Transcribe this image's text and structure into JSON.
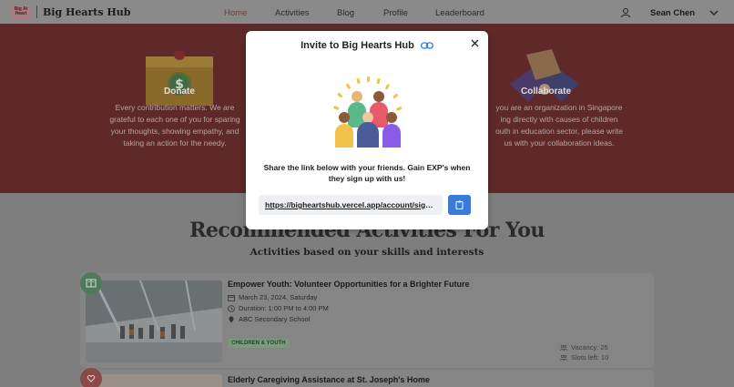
{
  "navbar": {
    "logo_text": "Big At Heart",
    "brand": "Big Hearts Hub",
    "links": [
      {
        "label": "Home",
        "active": true
      },
      {
        "label": "Activities",
        "active": false
      },
      {
        "label": "Blog",
        "active": false
      },
      {
        "label": "Profile",
        "active": false
      },
      {
        "label": "Leaderboard",
        "active": false
      }
    ],
    "user_icon": "user-icon",
    "user_name": "Sean Chen",
    "menu_icon": "chevron-down-icon"
  },
  "hero": {
    "donate": {
      "title": "Donate",
      "text_lines": [
        "Every contribution matters. We are",
        "grateful to each one of you for sparing",
        "your thoughts, showing empathy, and",
        "taking an action for the needy."
      ]
    },
    "collaborate": {
      "title": "Collaborate",
      "text_lines": [
        "you are an organization in Singapore",
        "ing directly with causes of children",
        "outh in education sector, please write",
        "us with your collaboration ideas."
      ]
    }
  },
  "section": {
    "heading": "Recommended Activities For You",
    "subheading": "Activities based on your skills and interests"
  },
  "activities": [
    {
      "title": "Empower Youth: Volunteer Opportunities for a Brighter Future",
      "date": "March 23, 2024, Saturday",
      "duration": "Duration: 1:00 PM to 4:00 PM",
      "location": "ABC Secondary School",
      "tag": "CHILDREN & YOUTH",
      "vacancy": "Vacancy: 25",
      "slots_left": "Slots left: 10",
      "badge_icon": "book-icon",
      "badge_color": "#4f7a5a"
    },
    {
      "title": "Elderly Caregiving Assistance at St. Joseph's Home",
      "badge_icon": "heart-hand-icon",
      "badge_color": "#8a4a4a"
    }
  ],
  "modal": {
    "title": "Invite to Big Hearts Hub",
    "title_icon": "link-icon",
    "message": "Share the link below with your friends. Gain EXP's when they sign up with us!",
    "link": "https://bigheartshub.vercel.app/account/signup",
    "close_icon": "close-icon",
    "copy_icon": "clipboard-icon",
    "accent_color": "#3b7bd8"
  }
}
